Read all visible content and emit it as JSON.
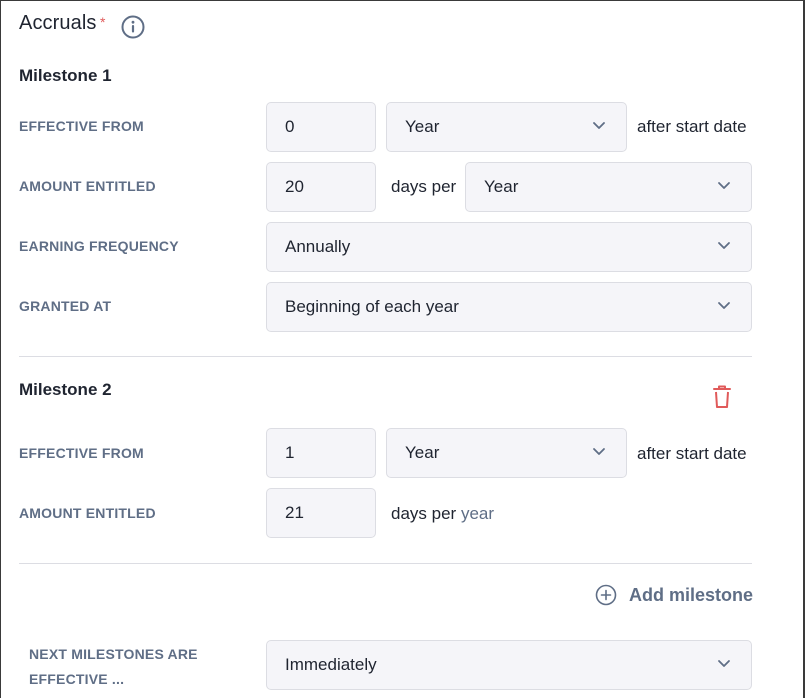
{
  "section": {
    "title": "Accruals",
    "required_mark": "*"
  },
  "milestone1": {
    "title": "Milestone 1",
    "effective_from": {
      "label": "EFFECTIVE FROM",
      "value": "0",
      "unit": "Year",
      "suffix": "after start date"
    },
    "amount_entitled": {
      "label": "AMOUNT ENTITLED",
      "value": "20",
      "middle": "days per",
      "unit": "Year"
    },
    "earning_frequency": {
      "label": "EARNING FREQUENCY",
      "value": "Annually"
    },
    "granted_at": {
      "label": "GRANTED AT",
      "value": "Beginning of each year"
    }
  },
  "milestone2": {
    "title": "Milestone 2",
    "effective_from": {
      "label": "EFFECTIVE FROM",
      "value": "1",
      "unit": "Year",
      "suffix": "after start date"
    },
    "amount_entitled": {
      "label": "AMOUNT ENTITLED",
      "value": "21",
      "middle": "days per",
      "unit": "year"
    }
  },
  "add_milestone": {
    "label": "Add milestone"
  },
  "next_milestones": {
    "label_line1": "NEXT MILESTONES ARE",
    "label_line2": "EFFECTIVE ...",
    "value": "Immediately"
  },
  "colors": {
    "accent_label": "#5f6e86",
    "danger": "#e05a5a",
    "field_bg": "#f5f5f9"
  }
}
